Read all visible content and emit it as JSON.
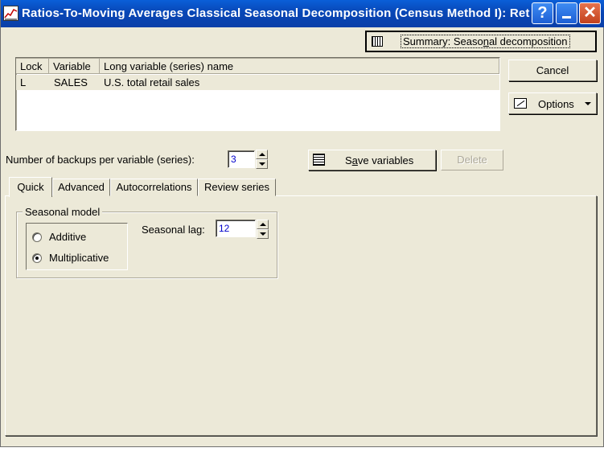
{
  "window": {
    "title": "Ratios-To-Moving Averages Classical Seasonal Decomposition (Census Method I): Ret",
    "help_glyph": "?",
    "close_glyph": "✕"
  },
  "toolbar": {
    "summary_label": "Summary: Seasonal decomposition",
    "cancel_label": "Cancel",
    "options_label": "Options"
  },
  "variables_table": {
    "columns": [
      "Lock",
      "Variable",
      "Long variable (series) name"
    ],
    "rows": [
      {
        "lock": "L",
        "variable": "SALES",
        "long_name": "U.S. total retail sales"
      }
    ]
  },
  "backups": {
    "label": "Number of backups per variable (series):",
    "value": "3"
  },
  "actions": {
    "save_label": "Save variables",
    "delete_label": "Delete"
  },
  "tabs": [
    {
      "label": "Quick",
      "active": true
    },
    {
      "label": "Advanced"
    },
    {
      "label": "Autocorrelations"
    },
    {
      "label": "Review series"
    }
  ],
  "seasonal_model": {
    "legend": "Seasonal model",
    "options": [
      {
        "label": "Additive",
        "selected": false
      },
      {
        "label": "Multiplicative",
        "selected": true
      }
    ],
    "lag_label": "Seasonal lag:",
    "lag_value": "12"
  },
  "icons": {
    "app": "chart-app-icon",
    "summary": "table-grid-icon",
    "options": "options-icon",
    "save": "save-variables-icon"
  }
}
